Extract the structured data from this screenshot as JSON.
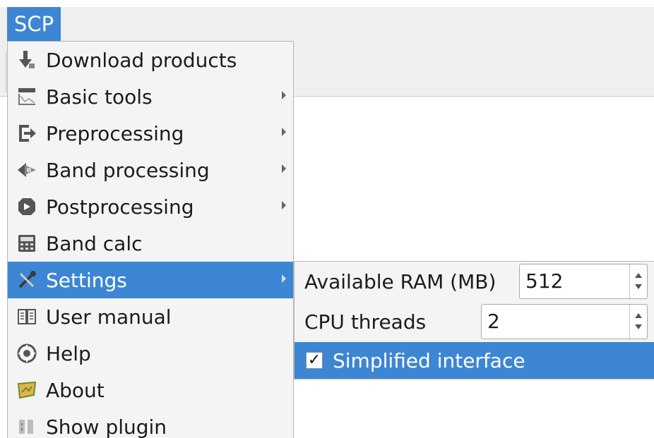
{
  "menubar": {
    "title": "SCP"
  },
  "menu": {
    "items": [
      {
        "label": "Download products",
        "icon": "download-icon",
        "has_submenu": false
      },
      {
        "label": "Basic tools",
        "icon": "basic-tools-icon",
        "has_submenu": true
      },
      {
        "label": "Preprocessing",
        "icon": "preprocessing-icon",
        "has_submenu": true
      },
      {
        "label": "Band processing",
        "icon": "band-processing-icon",
        "has_submenu": true
      },
      {
        "label": "Postprocessing",
        "icon": "postprocessing-icon",
        "has_submenu": true
      },
      {
        "label": "Band calc",
        "icon": "band-calc-icon",
        "has_submenu": false
      },
      {
        "label": "Settings",
        "icon": "settings-icon",
        "has_submenu": true,
        "active": true
      },
      {
        "label": "User manual",
        "icon": "user-manual-icon",
        "has_submenu": false
      },
      {
        "label": "Help",
        "icon": "help-icon",
        "has_submenu": false
      },
      {
        "label": "About",
        "icon": "about-icon",
        "has_submenu": false
      },
      {
        "label": "Show plugin",
        "icon": "show-plugin-icon",
        "has_submenu": false
      }
    ]
  },
  "settings_submenu": {
    "ram_label": "Available RAM (MB)",
    "ram_value": "512",
    "cpu_label": "CPU threads",
    "cpu_value": "2",
    "simplified_label": "Simplified interface",
    "simplified_checked": true
  },
  "colors": {
    "accent": "#3d86d3",
    "menu_bg": "#f4f4f4"
  }
}
